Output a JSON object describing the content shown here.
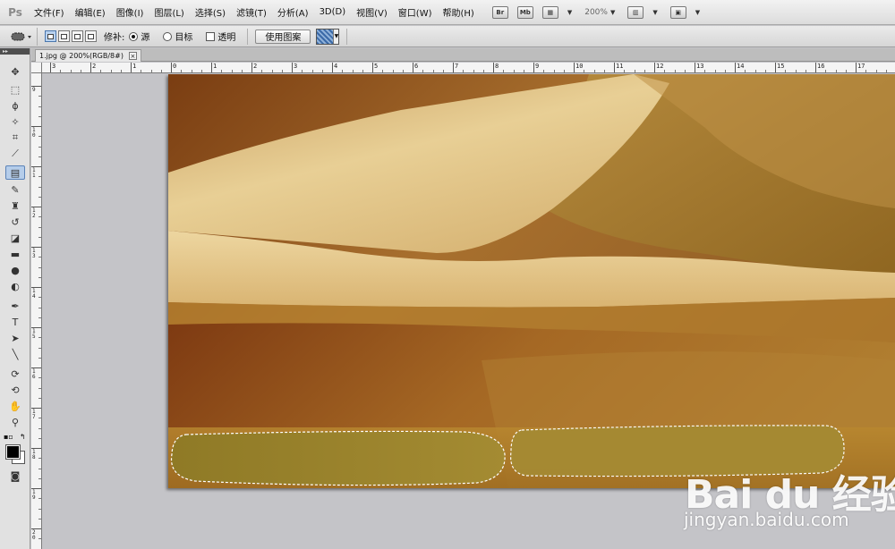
{
  "app": {
    "logo": "Ps"
  },
  "menus": [
    "文件(F)",
    "编辑(E)",
    "图像(I)",
    "图层(L)",
    "选择(S)",
    "滤镜(T)",
    "分析(A)",
    "3D(D)",
    "视图(V)",
    "窗口(W)",
    "帮助(H)"
  ],
  "appbar": {
    "bridge_label": "Br",
    "minibridge_label": "Mb",
    "zoom": "200%"
  },
  "options": {
    "patch_label": "修补:",
    "source_label": "源",
    "destination_label": "目标",
    "transparent_label": "透明",
    "use_pattern_label": "使用图案",
    "source_checked": true,
    "destination_checked": false,
    "transparent_checked": false
  },
  "document": {
    "tab_title": "1.jpg @ 200%(RGB/8#)",
    "close_glyph": "×"
  },
  "ruler_h_labels": [
    "3",
    "2",
    "1",
    "0",
    "1",
    "2",
    "3",
    "4",
    "5",
    "6",
    "7",
    "8",
    "9",
    "10",
    "11",
    "12",
    "13",
    "14",
    "15",
    "16",
    "17"
  ],
  "ruler_v_labels": [
    "9",
    "10",
    "11",
    "12",
    "13",
    "14",
    "15",
    "16",
    "17",
    "18",
    "19",
    "20"
  ],
  "colors": {
    "foreground": "#000000",
    "background": "#ffffff",
    "sand_light": "#e9cf92",
    "sand_dark": "#7a3d12"
  },
  "tools": [
    "move-icon",
    "marquee-icon",
    "lasso-icon",
    "quick-select-icon",
    "crop-icon",
    "eyedropper-icon",
    "patch-icon",
    "brush-icon",
    "stamp-icon",
    "history-brush-icon",
    "eraser-icon",
    "gradient-icon",
    "blur-icon",
    "dodge-icon",
    "pen-icon",
    "type-icon",
    "path-select-icon",
    "line-icon",
    "3d-rotate-icon",
    "3d-orbit-icon",
    "hand-icon",
    "zoom-icon"
  ],
  "watermark": {
    "logo": "Bai du 经验",
    "url": "jingyan.baidu.com"
  }
}
